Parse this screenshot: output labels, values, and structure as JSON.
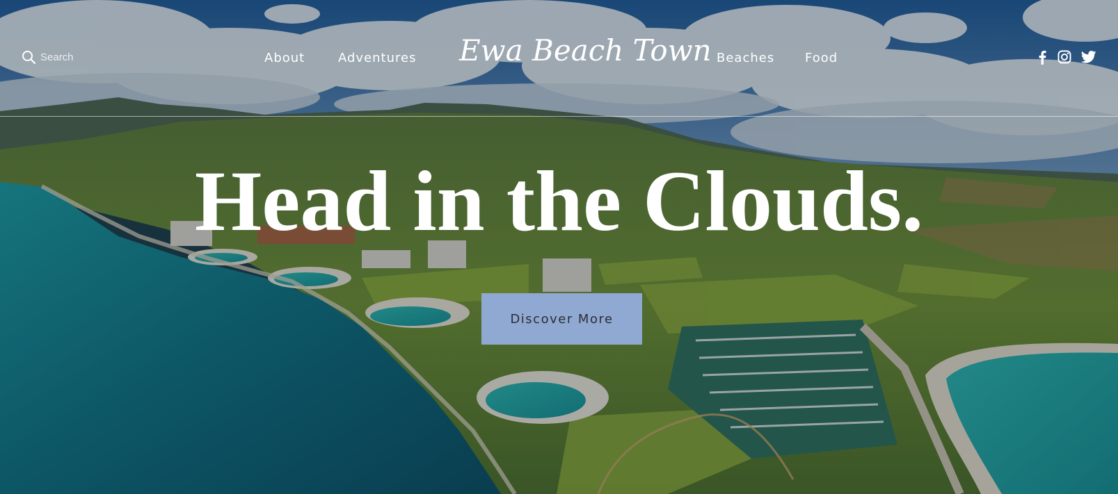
{
  "site": {
    "logo_text": "Ewa Beach Town"
  },
  "header": {
    "search_label": "Search",
    "nav": {
      "about": "About",
      "adventures": "Adventures",
      "beaches": "Beaches",
      "food": "Food"
    },
    "social_icons": [
      "facebook-icon",
      "instagram-icon",
      "twitter-icon"
    ]
  },
  "hero": {
    "headline": "Head in the Clouds.",
    "cta_label": "Discover More"
  },
  "colors": {
    "cta_background": "#8fa9d2",
    "cta_text": "#2d2d35",
    "text": "#ffffff"
  }
}
